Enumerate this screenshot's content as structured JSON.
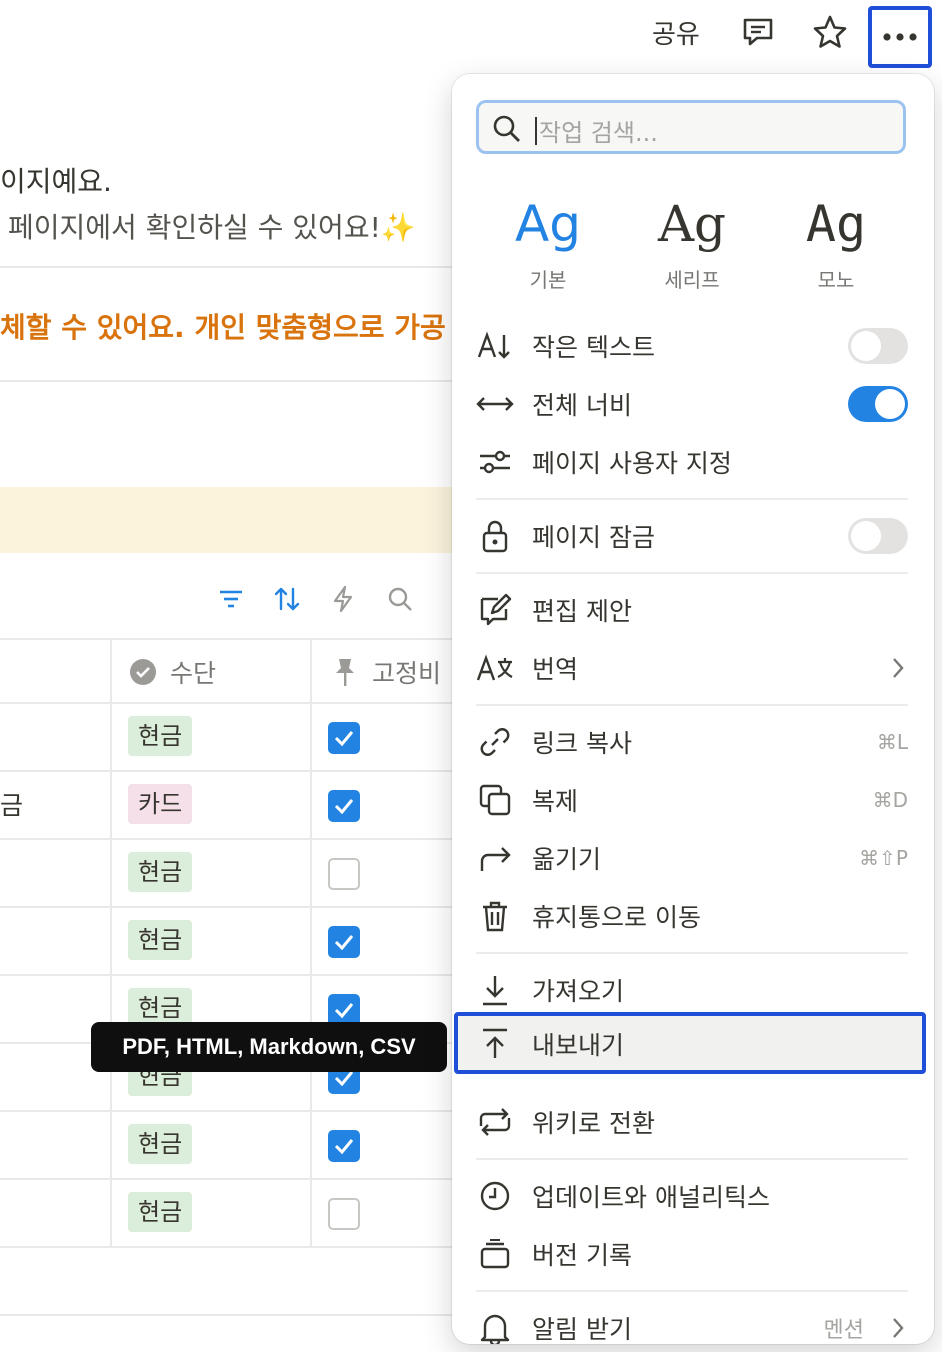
{
  "topbar": {
    "share_label": "공유",
    "icons": [
      "comment-icon",
      "star-icon",
      "more-icon"
    ]
  },
  "background": {
    "line1": "이지예요.",
    "line2": "페이지에서 확인하실 수 있어요!✨",
    "orange_text": "체할 수 있어요. 개인 맞춤형으로 가공",
    "table": {
      "columns": [
        "수단",
        "고정비"
      ],
      "rows": [
        {
          "left": "",
          "method": "현금",
          "fixed": true
        },
        {
          "left": "금",
          "method": "카드",
          "fixed": true
        },
        {
          "left": "",
          "method": "현금",
          "fixed": false
        },
        {
          "left": "",
          "method": "현금",
          "fixed": true
        },
        {
          "left": "",
          "method": "현금",
          "fixed": true
        },
        {
          "left": "",
          "method": "현금",
          "fixed": true
        },
        {
          "left": "",
          "method": "현금",
          "fixed": true
        },
        {
          "left": "",
          "method": "현금",
          "fixed": false
        }
      ]
    },
    "tooltip": "PDF, HTML, Markdown, CSV"
  },
  "menu": {
    "search_placeholder": "작업 검색...",
    "fonts": [
      {
        "sample": "Ag",
        "label": "기본",
        "selected": true
      },
      {
        "sample": "Ag",
        "label": "세리프",
        "selected": false
      },
      {
        "sample": "Ag",
        "label": "모노",
        "selected": false
      }
    ],
    "items": {
      "small_text": "작은 텍스트",
      "full_width": "전체 너비",
      "customize_page": "페이지 사용자 지정",
      "lock_page": "페이지 잠금",
      "suggest_edits": "편집 제안",
      "translate": "번역",
      "copy_link": "링크 복사",
      "copy_link_sc": "⌘L",
      "duplicate": "복제",
      "duplicate_sc": "⌘D",
      "move_to": "옮기기",
      "move_to_sc": "⌘⇧P",
      "move_to_trash": "휴지통으로 이동",
      "import": "가져오기",
      "export": "내보내기",
      "turn_into_wiki": "위키로 전환",
      "updates_analytics": "업데이트와 애널리틱스",
      "version_history": "버전 기록",
      "notify_me": "알림 받기",
      "notify_me_value": "멘션"
    },
    "toggles": {
      "small_text": false,
      "full_width": true,
      "lock_page": false
    },
    "accent_color": "#2383e2"
  }
}
